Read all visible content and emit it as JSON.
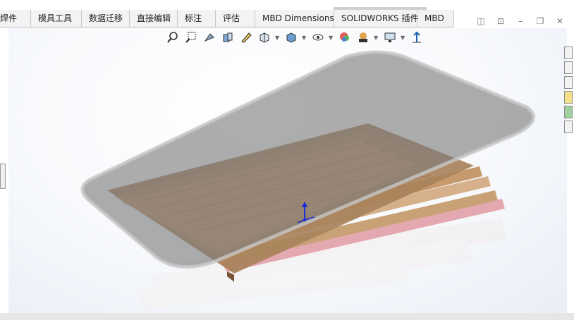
{
  "tabs": [
    {
      "label": "焊件"
    },
    {
      "label": "模具工具"
    },
    {
      "label": "数据迁移"
    },
    {
      "label": "直接编辑"
    },
    {
      "label": "标注"
    },
    {
      "label": "评估"
    },
    {
      "label": "MBD Dimensions"
    },
    {
      "label": "SOLIDWORKS 插件"
    },
    {
      "label": "MBD"
    }
  ],
  "heads_up_toolbar": [
    "zoom-to-fit-icon",
    "zoom-to-area-icon",
    "previous-view-icon",
    "section-view-icon",
    "dynamic-annotation-icon",
    "view-orientation-icon",
    "display-style-icon",
    "hide-show-items-icon",
    "edit-appearance-icon",
    "apply-scene-icon",
    "view-settings-icon",
    "triad-icon"
  ],
  "window_controls": [
    "restore-pane-icon",
    "next-pane-icon",
    "minimize-icon",
    "restore-icon",
    "close-icon"
  ],
  "task_pane": [
    "solidworks-resources-icon",
    "design-library-icon",
    "file-explorer-icon",
    "view-palette-icon",
    "appearances-icon",
    "custom-properties-icon"
  ],
  "colors": {
    "glass_top": "#8a8a8a",
    "wood": "#a7835a",
    "stripe": "#d8a0a8",
    "triad": "#1b2bd6"
  }
}
